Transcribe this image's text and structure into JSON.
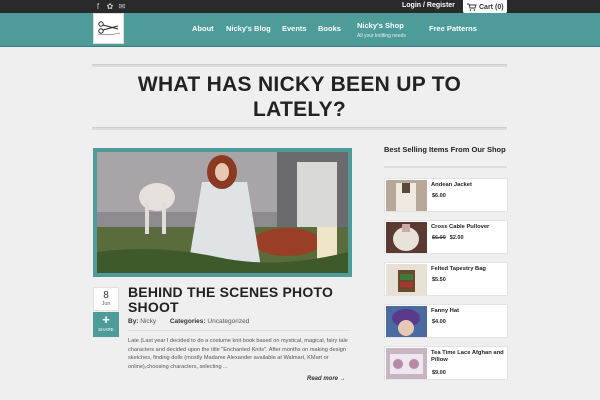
{
  "topbar": {
    "social_icons": [
      "facebook-icon",
      "twitter-icon",
      "email-icon"
    ],
    "login_label": "Login / Register",
    "cart_label": "Cart",
    "cart_count": "(0)"
  },
  "nav": {
    "items": [
      "About",
      "Nicky's Blog",
      "Events",
      "Books",
      "Nicky's Shop",
      "Free Patterns"
    ],
    "shop_subtitle": "All your knitting needs"
  },
  "page": {
    "title": "WHAT HAS NICKY BEEN UP TO LATELY?"
  },
  "post": {
    "day": "8",
    "month": "Jun",
    "share_label": "SHARE",
    "title": "BEHIND THE SCENES PHOTO SHOOT",
    "by_label": "By:",
    "author": "Nicky",
    "categories_label": "Categories:",
    "category": "Uncategorized",
    "excerpt": "Late (Last year I decided to do a costume knit book based on mystical, magical, fairy tale characters and decided upon the title \"Enchanted Knits\". After months on making design sketches, finding dolls (mostly Madame Alexander available at Walmart, KMart or online),choosing characters, selecting ...",
    "read_more": "Read more →"
  },
  "sidebar": {
    "title": "Best Selling Items From Our Shop",
    "products": [
      {
        "name": "Andean Jacket",
        "old_price": "",
        "price": "$6.00"
      },
      {
        "name": "Cross Cable Pullover",
        "old_price": "$6.00",
        "price": "$2.00"
      },
      {
        "name": "Felted Tapestry Bag",
        "old_price": "",
        "price": "$5.50"
      },
      {
        "name": "Fanny Hat",
        "old_price": "",
        "price": "$4.00"
      },
      {
        "name": "Tea Time Lace Afghan and Pillow",
        "old_price": "",
        "price": "$9.00"
      }
    ]
  },
  "colors": {
    "accent": "#4d9c9a",
    "topbar": "#2a2a2a",
    "background": "#efefef"
  }
}
